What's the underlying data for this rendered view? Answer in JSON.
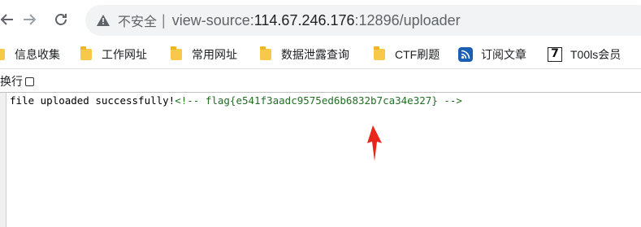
{
  "browser": {
    "back_icon": "back-arrow-icon",
    "forward_icon": "forward-arrow-icon",
    "reload_icon": "reload-icon",
    "address": {
      "warning_icon": "warning-triangle-icon",
      "insecure_label": "不安全",
      "separator": "|",
      "url_prefix": "view-source:",
      "url_host": "114.67.246.176",
      "url_suffix": ":12896/uploader"
    }
  },
  "bookmarks": [
    {
      "label": "信息收集",
      "icon": "folder-icon"
    },
    {
      "label": "工作网址",
      "icon": "folder-icon"
    },
    {
      "label": "常用网址",
      "icon": "folder-icon"
    },
    {
      "label": "数据泄露查询",
      "icon": "folder-icon"
    },
    {
      "label": "CTF刷题",
      "icon": "folder-icon"
    },
    {
      "label": "订阅文章",
      "icon": "rss-icon"
    },
    {
      "label": "T00ls会员",
      "icon": "t00ls-logo-icon"
    }
  ],
  "viewer": {
    "wrap_label": "换行",
    "wrap_checked": false
  },
  "source": {
    "text": "file uploaded successfully!",
    "comment": "<!-- flag{e541f3aadc9575ed6b6832b7ca34e327} -->"
  },
  "colors": {
    "comment": "#236e25",
    "annotation_arrow": "#e8261b",
    "folder": "#f7c84a"
  }
}
